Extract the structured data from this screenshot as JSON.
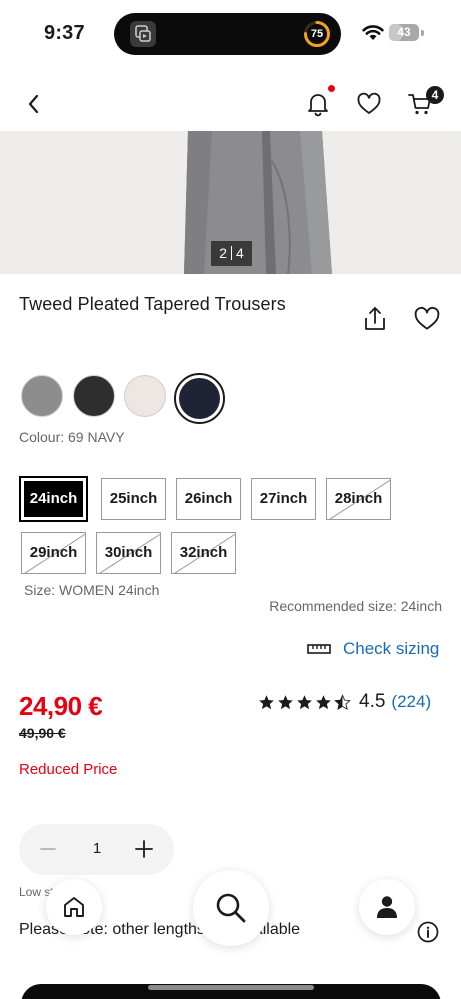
{
  "status_bar": {
    "time": "9:37",
    "activity_ring_value": "75",
    "battery_level": "43",
    "battery_fraction": 0.43
  },
  "header": {
    "back_icon": "chevron-left-icon",
    "notification_icon": "bell-icon",
    "wishlist_icon": "heart-icon",
    "cart_icon": "cart-icon",
    "cart_count": "4"
  },
  "gallery": {
    "current": "2",
    "total": "4"
  },
  "product": {
    "title": "Tweed Pleated Tapered Trousers",
    "colour_label": "Colour: 69 NAVY",
    "colours": [
      {
        "name": "grey",
        "hex": "#8d8d8d",
        "selected": false
      },
      {
        "name": "dark grey",
        "hex": "#2e2e2e",
        "selected": false
      },
      {
        "name": "off white",
        "hex": "#ede6e2",
        "selected": false
      },
      {
        "name": "navy",
        "hex": "#1e2335",
        "selected": true
      }
    ],
    "sizes": [
      {
        "label": "24inch",
        "state": "selected"
      },
      {
        "label": "25inch",
        "state": "available"
      },
      {
        "label": "26inch",
        "state": "available"
      },
      {
        "label": "27inch",
        "state": "available"
      },
      {
        "label": "28inch",
        "state": "unavailable"
      },
      {
        "label": "29inch",
        "state": "unavailable"
      },
      {
        "label": "30inch",
        "state": "unavailable"
      },
      {
        "label": "32inch",
        "state": "unavailable"
      }
    ],
    "size_label": "Size: WOMEN 24inch",
    "recommended_size": "Recommended size: 24inch",
    "check_sizing": "Check sizing",
    "price": "24,90 €",
    "old_price": "49,90 €",
    "reduced_label": "Reduced Price",
    "rating": "4.5",
    "rating_count": "(224)",
    "quantity": "1",
    "low_stock": "Low stock",
    "note": "Please note: other lengths are available"
  },
  "colors": {
    "accent_red": "#e60012",
    "link_blue": "#1b6bb3",
    "text": "#1b1b1b"
  }
}
